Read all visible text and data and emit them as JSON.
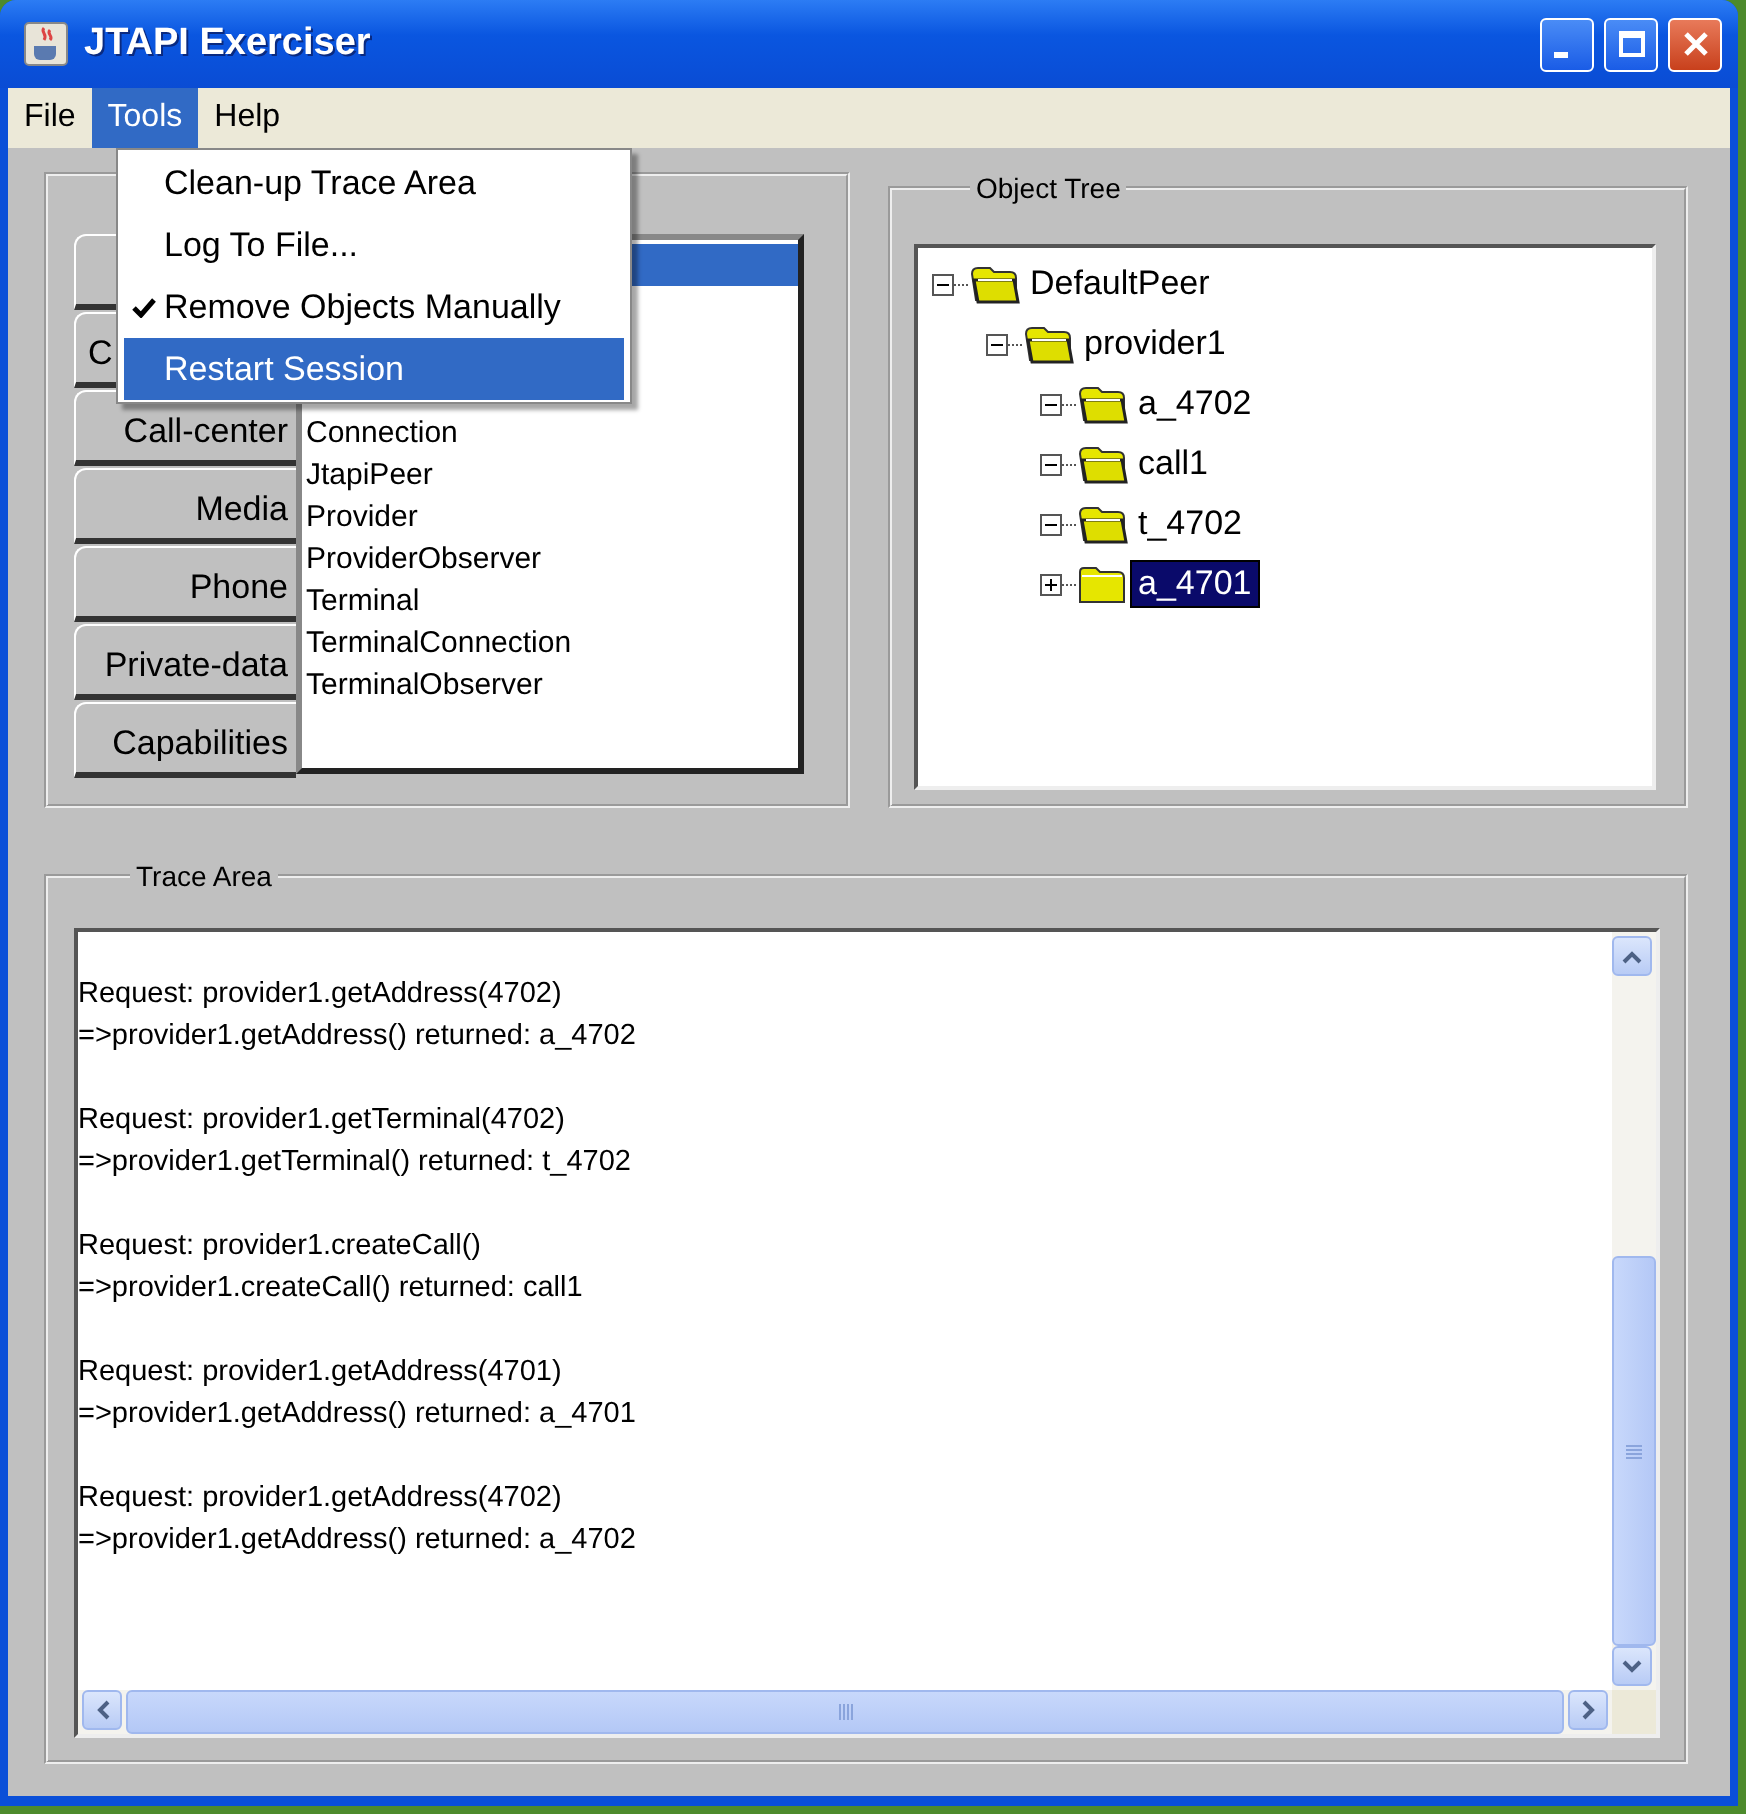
{
  "window": {
    "title": "JTAPI Exerciser"
  },
  "menubar": [
    {
      "label": "File",
      "selected": false
    },
    {
      "label": "Tools",
      "selected": true
    },
    {
      "label": "Help",
      "selected": false
    }
  ],
  "open_menu": {
    "items": [
      {
        "label": "Clean-up Trace Area",
        "checked": false,
        "selected": false
      },
      {
        "label": "Log To File...",
        "checked": false,
        "selected": false
      },
      {
        "label": "Remove Objects Manually",
        "checked": true,
        "selected": false
      },
      {
        "label": "Restart Session",
        "checked": false,
        "selected": true
      }
    ]
  },
  "object_panel": {
    "tabs": [
      {
        "kind": "covered"
      },
      {
        "kind": "cut",
        "label": "C"
      },
      {
        "kind": "full",
        "label": "Call-center"
      },
      {
        "kind": "full",
        "label": "Media"
      },
      {
        "kind": "full",
        "label": "Phone"
      },
      {
        "kind": "full",
        "label": "Private-data"
      },
      {
        "kind": "full",
        "label": "Capabilities"
      }
    ],
    "list": [
      {
        "selected": true
      },
      {
        "selected": false
      },
      {
        "selected": false
      },
      {
        "selected": false
      },
      {
        "label": "Connection",
        "selected": false
      },
      {
        "label": "JtapiPeer",
        "selected": false
      },
      {
        "label": "Provider",
        "selected": false
      },
      {
        "label": "ProviderObserver",
        "selected": false
      },
      {
        "label": "Terminal",
        "selected": false
      },
      {
        "label": "TerminalConnection",
        "selected": false
      },
      {
        "label": "TerminalObserver",
        "selected": false
      }
    ]
  },
  "object_tree": {
    "title": "Object Tree",
    "nodes": [
      {
        "label": "DefaultPeer",
        "expanded": true,
        "selected": false,
        "children": [
          {
            "label": "provider1",
            "expanded": true,
            "selected": false,
            "children": [
              {
                "label": "a_4702",
                "expanded": true,
                "selected": false
              },
              {
                "label": "call1",
                "expanded": true,
                "selected": false
              },
              {
                "label": "t_4702",
                "expanded": true,
                "selected": false
              },
              {
                "label": "a_4701",
                "expanded": false,
                "selected": true
              }
            ]
          }
        ]
      }
    ]
  },
  "trace_area": {
    "title": "Trace Area",
    "entries": [
      {
        "request": "Request: provider1.getAddress(4702)",
        "response": "=>provider1.getAddress() returned: a_4702"
      },
      {
        "request": "Request: provider1.getTerminal(4702)",
        "response": "=>provider1.getTerminal() returned: t_4702"
      },
      {
        "request": "Request: provider1.createCall()",
        "response": "=>provider1.createCall() returned: call1"
      },
      {
        "request": "Request: provider1.getAddress(4701)",
        "response": "=>provider1.getAddress() returned: a_4701"
      },
      {
        "request": "Request: provider1.getAddress(4702)",
        "response": "=>provider1.getAddress() returned: a_4702"
      }
    ]
  }
}
